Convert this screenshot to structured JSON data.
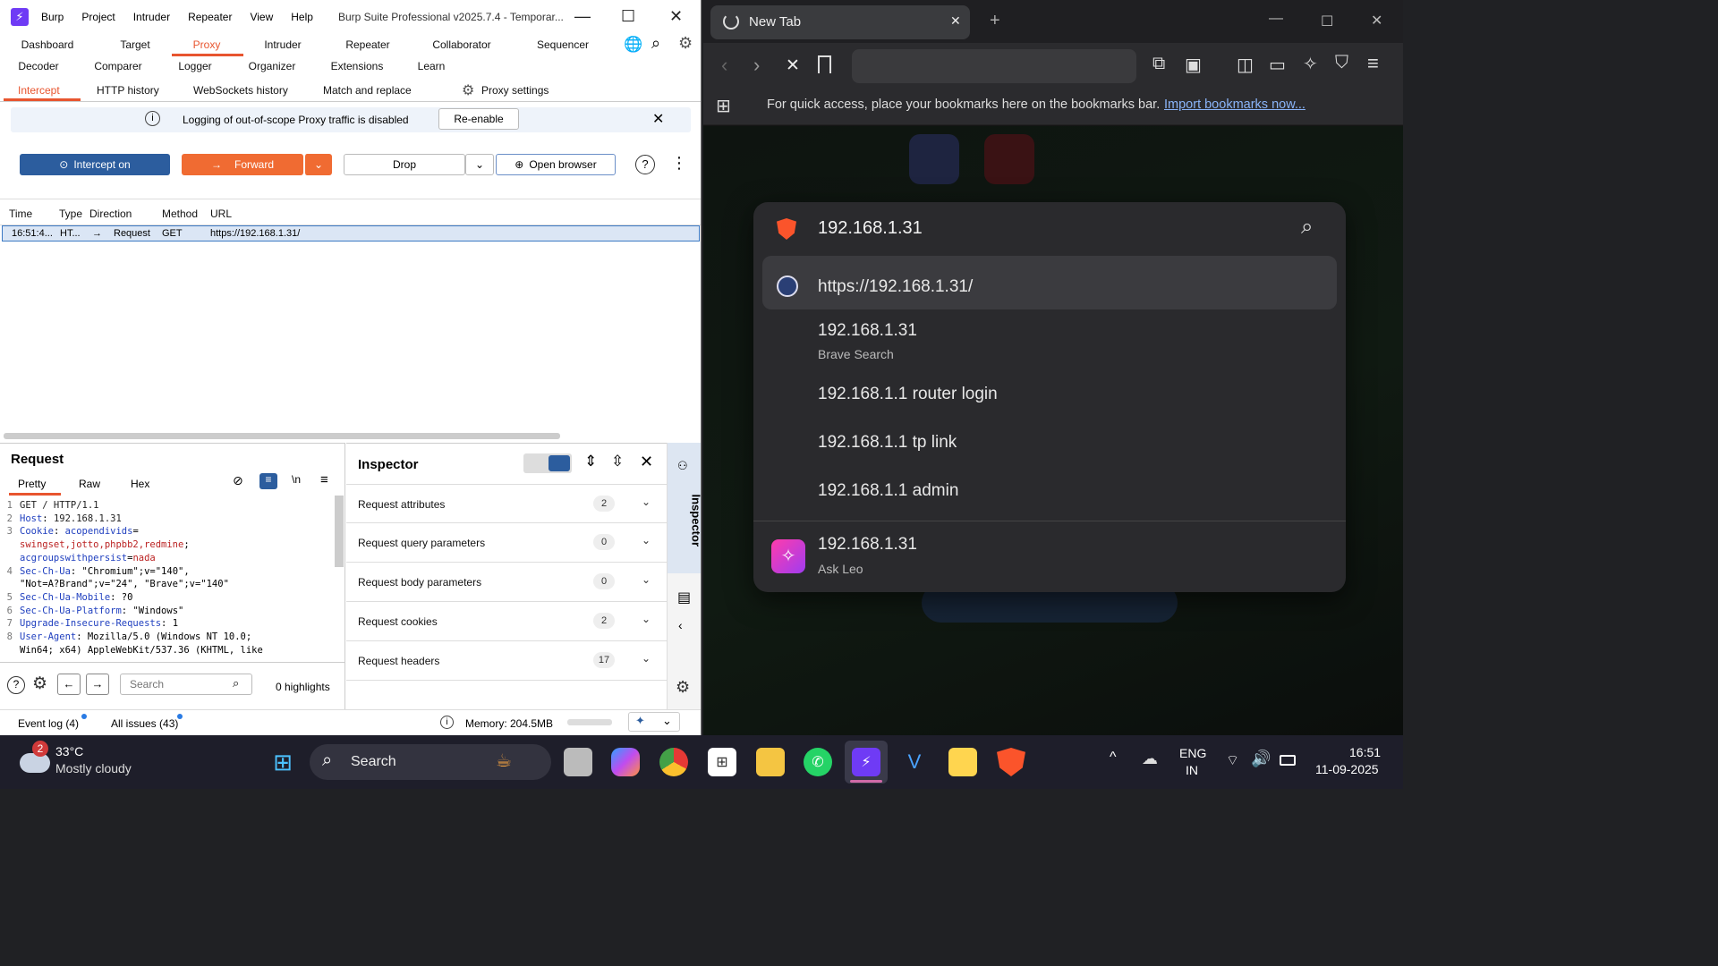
{
  "burp": {
    "menu": [
      "Burp",
      "Project",
      "Intruder",
      "Repeater",
      "View",
      "Help"
    ],
    "title": "Burp Suite Professional v2025.7.4 - Temporar...",
    "tabs_row1": [
      "Dashboard",
      "Target",
      "Proxy",
      "Intruder",
      "Repeater",
      "Collaborator",
      "Sequencer"
    ],
    "tabs_row2": [
      "Decoder",
      "Comparer",
      "Logger",
      "Organizer",
      "Extensions",
      "Learn"
    ],
    "subtabs": [
      "Intercept",
      "HTTP history",
      "WebSockets history",
      "Match and replace",
      "Proxy settings"
    ],
    "banner_text": "Logging of out-of-scope Proxy traffic is disabled",
    "reenable": "Re-enable",
    "intercept_on": "Intercept on",
    "forward": "Forward",
    "drop": "Drop",
    "open_browser": "Open browser",
    "columns": [
      "Time",
      "Type",
      "Direction",
      "Method",
      "URL"
    ],
    "row": {
      "time": "16:51:4...",
      "type": "HT...",
      "direction": "Request",
      "method": "GET",
      "url": "https://192.168.1.31/"
    },
    "request_title": "Request",
    "req_tabs": [
      "Pretty",
      "Raw",
      "Hex"
    ],
    "search_placeholder": "Search",
    "highlights": "0 highlights",
    "inspector_title": "Inspector",
    "inspector_side": "Inspector",
    "inspector_rows": [
      {
        "label": "Request attributes",
        "count": "2"
      },
      {
        "label": "Request query parameters",
        "count": "0"
      },
      {
        "label": "Request body parameters",
        "count": "0"
      },
      {
        "label": "Request cookies",
        "count": "2"
      },
      {
        "label": "Request headers",
        "count": "17"
      }
    ],
    "event_log": "Event log (4)",
    "all_issues": "All issues (43)",
    "memory": "Memory: 204.5MB"
  },
  "brave": {
    "tab_title": "New Tab",
    "bookmarks_text": "For quick access, place your bookmarks here on the bookmarks bar.",
    "import_link": "Import bookmarks now...",
    "omnibox_text": "192.168.1.31",
    "suggestions": [
      {
        "main": "https://192.168.1.31/",
        "sub": ""
      },
      {
        "main": "192.168.1.31",
        "sub": "Brave Search"
      },
      {
        "main": "192.168.1.1 router login",
        "sub": ""
      },
      {
        "main": "192.168.1.1 tp link",
        "sub": ""
      },
      {
        "main": "192.168.1.1 admin",
        "sub": ""
      },
      {
        "main": "192.168.1.31",
        "sub": "Ask Leo"
      }
    ]
  },
  "taskbar": {
    "weather_temp": "33°C",
    "weather_desc": "Mostly cloudy",
    "weather_badge": "2",
    "search_label": "Search",
    "lang1": "ENG",
    "lang2": "IN",
    "time": "16:51",
    "date": "11-09-2025"
  }
}
